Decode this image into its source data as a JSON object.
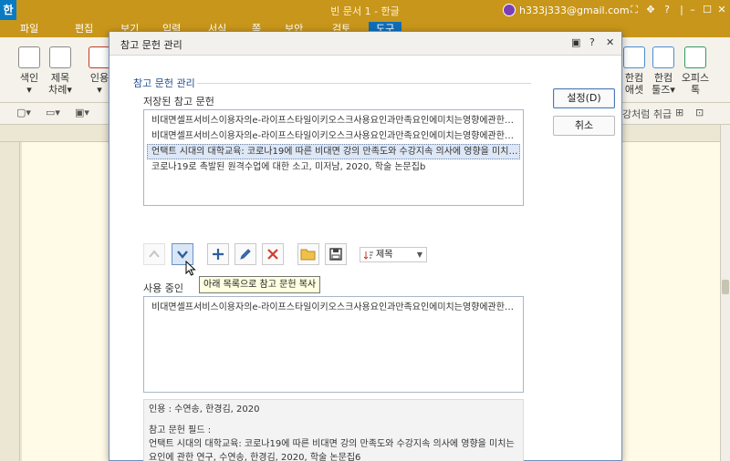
{
  "app": {
    "logo": "한",
    "doc_title": "빈 문서 1 - 한글",
    "account_email": "h333j333@gmail.com",
    "window_controls": [
      "⛶",
      "✥",
      "?",
      "|",
      "–",
      "☐",
      "✕"
    ]
  },
  "menubar": {
    "items": [
      "파일",
      "편집",
      "보기",
      "입력",
      "서식",
      "쪽",
      "보안",
      "검토",
      "도구"
    ],
    "active": "도구"
  },
  "ribbon": {
    "left": [
      {
        "label_1": "색인",
        "label_2": "▾"
      },
      {
        "label_1": "제목",
        "label_2": "차례▾"
      },
      {
        "label_1": "인용",
        "label_2": "▾"
      }
    ],
    "right": [
      {
        "label_1": "한컴",
        "label_2": "애셋"
      },
      {
        "label_1": "한컴",
        "label_2": "툴즈▾"
      },
      {
        "label_1": "오피스",
        "label_2": "톡"
      }
    ],
    "qt_right_text": "강처럼 취급"
  },
  "dialog": {
    "title": "참고 문헌 관리",
    "controls": [
      "▣",
      "?",
      "✕"
    ],
    "group_title": "참고 문헌 관리",
    "saved_label": "저장된 참고 문헌",
    "saved_items": [
      "비대면셀프서비스이용자의e-라이프스타일이키오스크사용요인과만족요인에미치는영향에관한…",
      "비대면셀프서비스이용자의e-라이프스타일이키오스크사용요인과만족요인에미치는영향에관한…",
      "언택트 시대의 대학교육: 코로나19에 따른 비대면 강의 만족도와 수강지속 의사에 영향을 미치…",
      "코로나19로 촉발된 원격수업에 대한 소고, 미저남, 2020, 학술 논문집b"
    ],
    "selected_index": 2,
    "ok_label": "설정(D)",
    "cancel_label": "취소",
    "sort_label": "제목",
    "tooltip": "아래 목록으로 참고 문헌 복사",
    "in_use_label": "사용 중인",
    "in_use_items": [
      "비대면셀프서비스이용자의e-라이프스타일이키오스크사용요인과만족요인에미치는영향에관한…"
    ],
    "info": {
      "citation": "인용 : 수연송, 한경김, 2020",
      "field_label": "참고 문헌 필드 :",
      "field_line_1": "언택트 시대의 대학교육: 코로나19에 따른 비대면 강의 만족도와 수강지속 의사에 영향을 미치는",
      "field_line_2": "요인에 관한 연구, 수연송, 한경김, 2020, 학술 논문집6"
    }
  },
  "colors": {
    "titlebar": "#c8961a",
    "active_tab": "#0f6db8",
    "selection": "#dde7f5",
    "delete_red": "#d23c2c",
    "accent_blue": "#2d5f9e"
  }
}
